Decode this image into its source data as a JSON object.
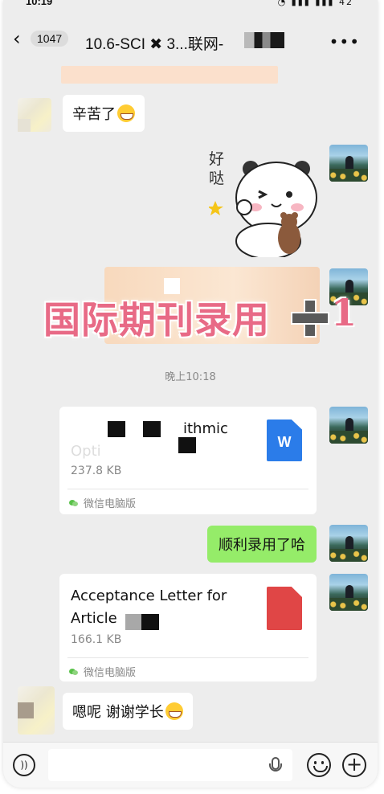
{
  "status_bar": {
    "time": "10:19",
    "battery": "42"
  },
  "header": {
    "back_icon": "chevron-left-icon",
    "unread_count": "1047",
    "title": "10.6-SCI ✖ 3...联网-",
    "more_icon": "more-dots-icon"
  },
  "messages": {
    "m1_text": "辛苦了",
    "sticker_text": "好哒",
    "stamp_text": "国际期刊录用",
    "stamp_suffix": "1",
    "time_divider": "晚上10:18",
    "file1": {
      "name_line1": "ithmic",
      "name_line2": "Opti",
      "size": "237.8 KB",
      "source": "微信电脑版",
      "icon_label": "W",
      "icon": "word-file-icon"
    },
    "m_green_text": "顺利录用了哈",
    "file2": {
      "name_line1": "Acceptance Letter for",
      "name_line2": "Article",
      "size": "166.1 KB",
      "source": "微信电脑版",
      "icon": "pdf-file-icon"
    },
    "m_last_text": "嗯呢 谢谢学长"
  },
  "input_bar": {
    "voice_icon": "voice-icon",
    "placeholder": "",
    "mic_icon": "mic-icon",
    "emoji_icon": "emoji-icon",
    "plus_icon": "plus-icon"
  },
  "colors": {
    "bg": "#ededed",
    "green_bubble": "#95ec69",
    "stamp": "#e86a86",
    "word_blue": "#2b7ce9",
    "pdf_red": "#e04646"
  }
}
